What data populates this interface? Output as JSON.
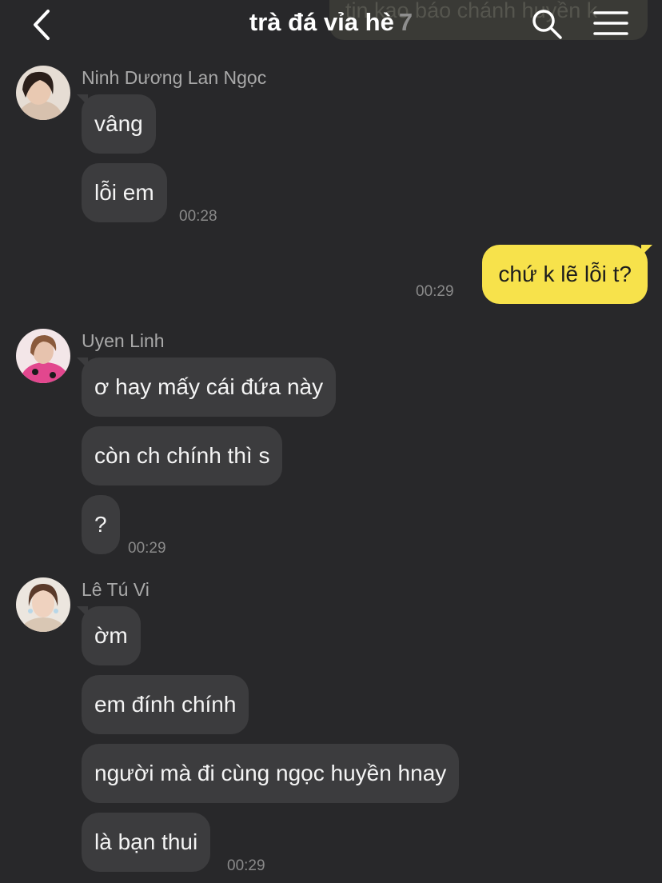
{
  "header": {
    "pinned_notice": "tin kao báo chánh huyền k",
    "title": "trà đá vỉa hè",
    "member_count": "7",
    "back_icon": "chevron-left-icon",
    "search_icon": "search-icon",
    "menu_icon": "hamburger-menu-icon"
  },
  "colors": {
    "background": "#28282a",
    "incoming_bubble": "#3c3c3e",
    "outgoing_bubble": "#f7e24b",
    "timestamp": "#8a8a8a"
  },
  "messages": {
    "group1": {
      "sender": "Ninh Dương Lan Ngọc",
      "texts": [
        "vâng",
        "lỗi em"
      ],
      "time": "00:28"
    },
    "mine": {
      "text": "chứ k lẽ lỗi t?",
      "time": "00:29"
    },
    "group2": {
      "sender": "Uyen Linh",
      "texts": [
        "ơ hay mấy cái đứa này",
        "còn ch chính thì s",
        "?"
      ],
      "time": "00:29"
    },
    "group3": {
      "sender": "Lê Tú Vi",
      "texts": [
        "ờm",
        "em đính chính",
        "người mà đi cùng ngọc huyền hnay",
        "là bạn thui"
      ],
      "time": "00:29"
    }
  }
}
